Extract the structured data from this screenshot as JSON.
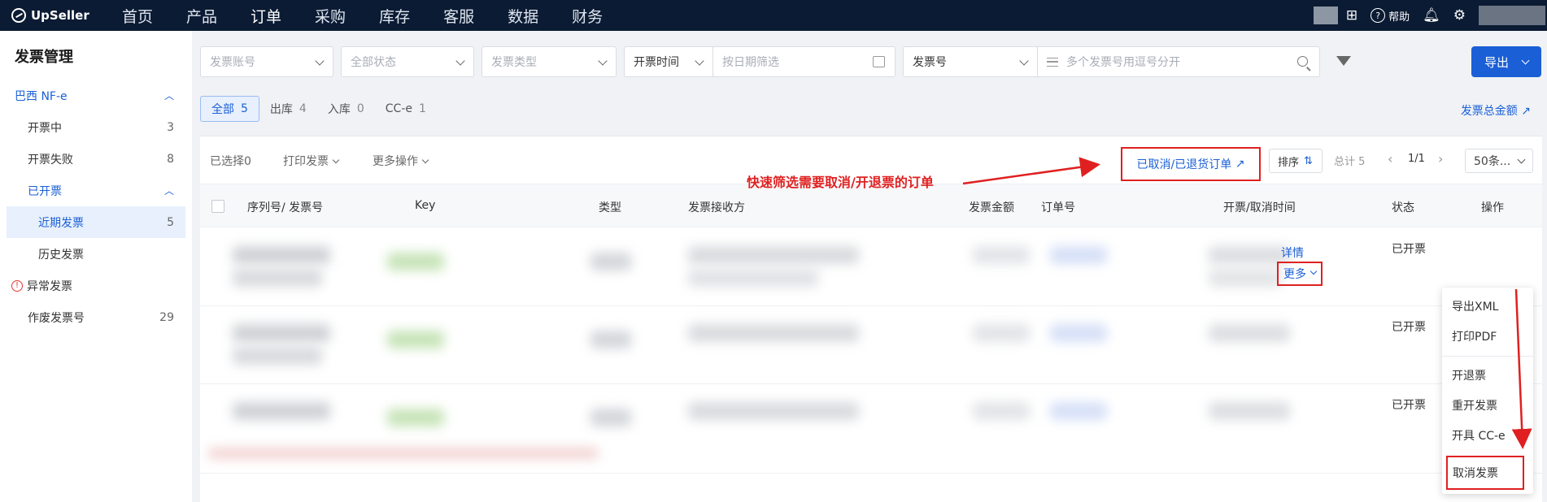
{
  "brand": {
    "name": "UpSeller"
  },
  "topnav": {
    "items": [
      "首页",
      "产品",
      "订单",
      "采购",
      "库存",
      "客服",
      "数据",
      "财务"
    ],
    "active": "订单",
    "help_label": "帮助"
  },
  "sidebar": {
    "title": "发票管理",
    "groups": [
      {
        "label": "巴西 NF-e"
      },
      {
        "label": "开票中",
        "count": "3"
      },
      {
        "label": "开票失败",
        "count": "8"
      },
      {
        "label": "已开票"
      },
      {
        "label": "近期发票",
        "count": "5"
      },
      {
        "label": "历史发票"
      },
      {
        "label": "异常发票"
      },
      {
        "label": "作废发票号",
        "count": "29"
      }
    ]
  },
  "filters": {
    "account_placeholder": "发票账号",
    "status_placeholder": "全部状态",
    "type_placeholder": "发票类型",
    "time_select": "开票时间",
    "date_placeholder": "按日期筛选",
    "number_select": "发票号",
    "number_placeholder": "多个发票号用逗号分开",
    "export_label": "导出"
  },
  "tabs": [
    {
      "label": "全部",
      "count": "5"
    },
    {
      "label": "出库",
      "count": "4"
    },
    {
      "label": "入库",
      "count": "0"
    },
    {
      "label": "CC-e",
      "count": "1"
    }
  ],
  "total_amount_link": "发票总金额",
  "toolbar": {
    "selected": "已选择0",
    "print": "打印发票",
    "more_ops": "更多操作",
    "cancelled_link": "已取消/已退货订单",
    "sort": "排序",
    "total": "总计 5",
    "page": "1/1",
    "per_page": "50条..."
  },
  "annotation": "快速筛选需要取消/开退票的订单",
  "table": {
    "headers": [
      "序列号/ 发票号",
      "Key",
      "类型",
      "发票接收方",
      "发票金额",
      "订单号",
      "开票/取消时间",
      "状态",
      "操作"
    ],
    "rows": [
      {
        "status": "已开票"
      },
      {
        "status": "已开票"
      },
      {
        "status": "已开票"
      }
    ],
    "detail_label": "详情",
    "more_label": "更多"
  },
  "menu": {
    "items": [
      "导出XML",
      "打印PDF",
      "开退票",
      "重开发票",
      "开具 CC-e",
      "取消发票"
    ]
  },
  "colors": {
    "nav_bg": "#0b1b33",
    "accent": "#1a5fd6",
    "annotation": "#e02020"
  }
}
